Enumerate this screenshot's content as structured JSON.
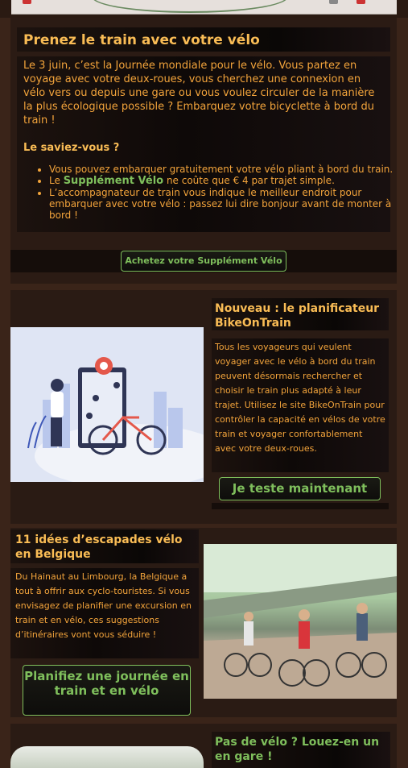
{
  "section1": {
    "title": "Prenez le train avec votre vélo",
    "intro": "Le 3 juin, c’est la Journée mondiale pour le vélo. Vous partez en voyage avec votre deux-roues, vous cherchez une connexion en vélo vers ou depuis une gare ou vous voulez circuler de la manière la plus écologique possible ? Embarquez votre bicyclette à bord du train !",
    "subheading": "Le saviez-vous ?",
    "bullet1": "Vous pouvez embarquer gratuitement votre vélo pliant à bord du train.",
    "bullet2_prefix": "Le",
    "bullet2_highlight": "Supplément Vélo",
    "bullet2_suffix": "ne coûte que € 4 par trajet simple.",
    "bullet3": "L’accompagnateur de train vous indique le meilleur endroit pour embarquer avec votre vélo : passez lui dire bonjour avant de monter à bord !",
    "button": "Achetez votre Supplément Vélo"
  },
  "section2": {
    "title": "Nouveau : le planificateur BikeOnTrain",
    "body": "Tous les voyageurs qui veulent voyager avec le vélo à bord du train peuvent désormais rechercher et choisir le train plus adapté à leur trajet. Utilisez le site BikeOnTrain pour contrôler la capacité en vélos de votre train et voyager confortablement avec votre deux-roues.",
    "button": "Je teste maintenant",
    "image": "bike-planner-illustration"
  },
  "section3": {
    "title": "11 idées d’escapades vélo en Belgique",
    "body": "Du Hainaut au Limbourg, la Belgique a tout à offrir aux cyclo-touristes. Si vous envisagez de planifier une excursion en train et en vélo, ces suggestions d’itinéraires vont vous séduire !",
    "button": "Planifiez une journée en train et en vélo",
    "image": "cyclists-photo"
  },
  "section4": {
    "title": "Pas de vélo ? Louez-en un en gare !"
  },
  "colors": {
    "accent": "#f3a43b",
    "title": "#f9bc55",
    "green": "#7fbf5c",
    "background": "#3a2419"
  }
}
